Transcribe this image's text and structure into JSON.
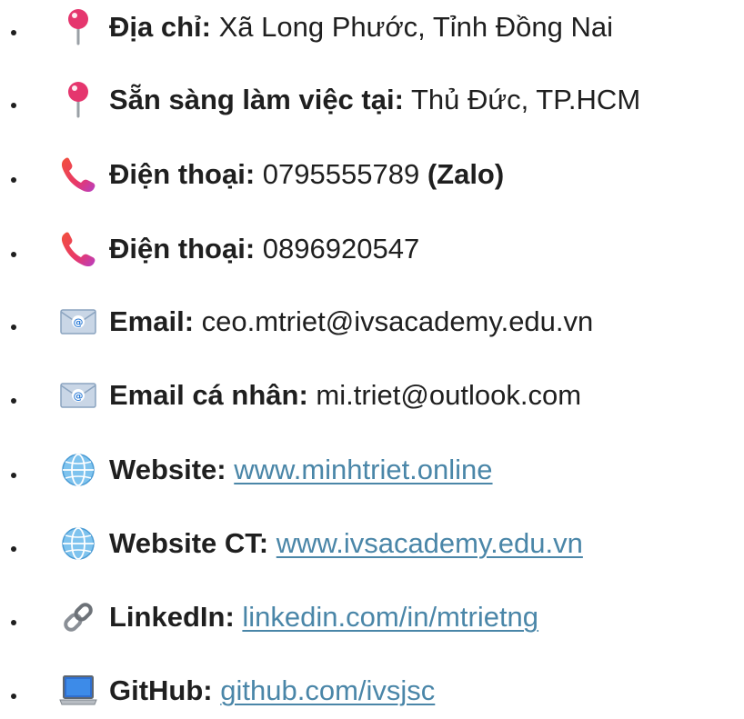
{
  "contacts": [
    {
      "icon": "pushpin-icon",
      "label": "Địa chỉ:",
      "value": " Xã Long Phước, Tỉnh Đồng Nai",
      "suffix": ""
    },
    {
      "icon": "pushpin-icon",
      "label": "Sẵn sàng làm việc tại:",
      "value": " Thủ Đức, TP.HCM",
      "suffix": ""
    },
    {
      "icon": "phone-icon",
      "label": "Điện thoại:",
      "value": " 0795555789 ",
      "suffix": "(Zalo)"
    },
    {
      "icon": "phone-icon",
      "label": "Điện thoại:",
      "value": " 0896920547",
      "suffix": ""
    },
    {
      "icon": "envelope-icon",
      "label": "Email:",
      "value": " ceo.mtriet@ivsacademy.edu.vn",
      "suffix": ""
    },
    {
      "icon": "envelope-icon",
      "label": "Email cá nhân:",
      "value": " mi.triet@outlook.com",
      "suffix": ""
    },
    {
      "icon": "globe-icon",
      "label": "Website:",
      "value": "www.minhtriet.online",
      "suffix": ""
    },
    {
      "icon": "globe-icon",
      "label": "Website CT:",
      "value": "www.ivsacademy.edu.vn",
      "suffix": ""
    },
    {
      "icon": "link-icon",
      "label": "LinkedIn:",
      "value": "linkedin.com/in/mtrietng",
      "suffix": ""
    },
    {
      "icon": "laptop-icon",
      "label": "GitHub:",
      "value": "github.com/ivsjsc",
      "suffix": ""
    }
  ]
}
